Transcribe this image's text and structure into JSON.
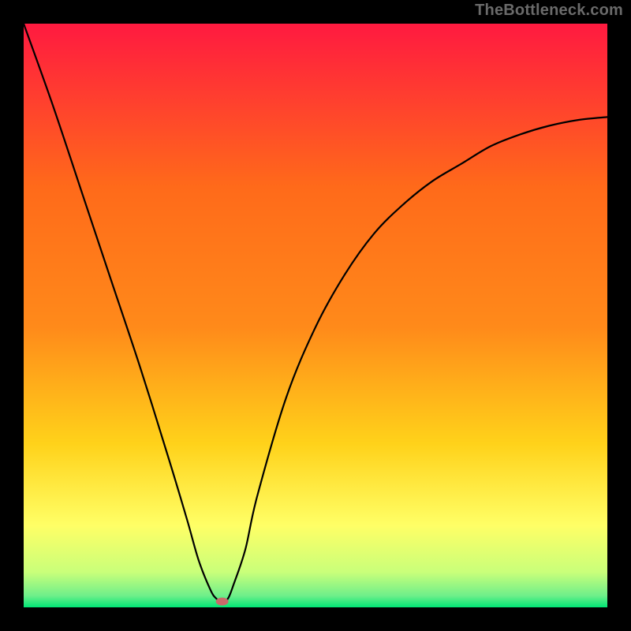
{
  "watermark": "TheBottleneck.com",
  "chart_data": {
    "type": "line",
    "title": "",
    "xlabel": "",
    "ylabel": "",
    "xlim": [
      0,
      100
    ],
    "ylim": [
      0,
      100
    ],
    "grid": false,
    "legend": false,
    "gradient_colors": {
      "top": "#ff1a40",
      "mid_upper": "#ff8a1a",
      "mid": "#ffd21a",
      "mid_lower": "#ffff66",
      "bottom_upper": "#d9ff66",
      "bottom": "#00e676"
    },
    "series": [
      {
        "name": "bottleneck-curve",
        "x": [
          0,
          5,
          10,
          15,
          20,
          25,
          28,
          30,
          32,
          33,
          34,
          35,
          36,
          38,
          40,
          45,
          50,
          55,
          60,
          65,
          70,
          75,
          80,
          85,
          90,
          95,
          100
        ],
        "y": [
          100,
          86,
          71,
          56,
          41,
          25,
          15,
          8,
          3,
          1.5,
          1,
          1.5,
          4,
          10,
          19,
          36,
          48,
          57,
          64,
          69,
          73,
          76,
          79,
          81,
          82.5,
          83.5,
          84
        ]
      }
    ],
    "marker": {
      "name": "optimal-point",
      "x": 34,
      "y": 1,
      "color": "#c96a6a"
    }
  }
}
